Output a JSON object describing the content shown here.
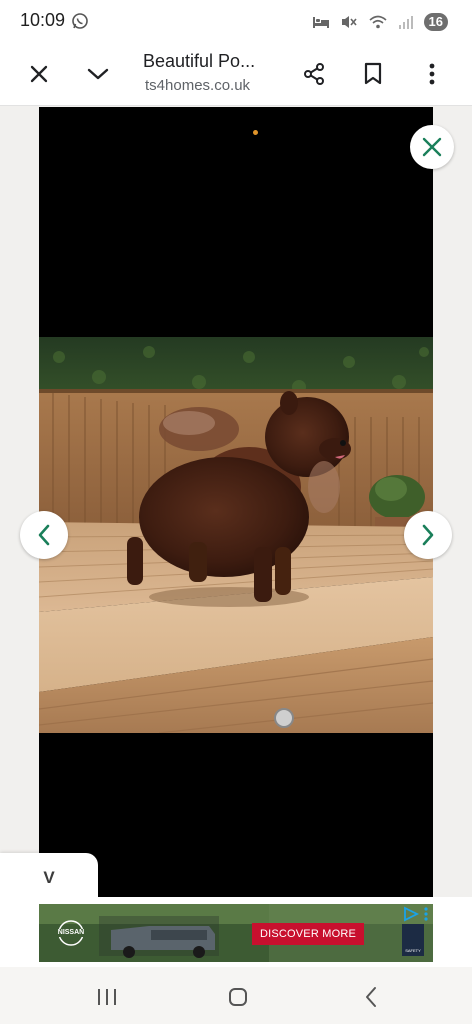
{
  "status_bar": {
    "time": "10:09",
    "battery": "16",
    "icons": [
      "whatsapp-icon",
      "bed-icon",
      "mute-icon",
      "wifi-icon",
      "signal-icon"
    ]
  },
  "toolbar": {
    "title": "Beautiful Po...",
    "url": "ts4homes.co.uk",
    "icons": [
      "close-icon",
      "chevron-down-icon",
      "share-icon",
      "bookmark-icon",
      "more-vert-icon"
    ]
  },
  "viewer": {
    "close_icon": "close-icon",
    "prev_icon": "chevron-left-icon",
    "next_icon": "chevron-right-icon"
  },
  "collapse_tab": {
    "label": "V"
  },
  "ad": {
    "brand": "NISSAN",
    "cta": "DISCOVER MORE",
    "badge": "SAFETY"
  },
  "nav_bar": {
    "icons": [
      "recent-apps-icon",
      "home-icon",
      "back-icon"
    ]
  },
  "colors": {
    "accent_green": "#1a7f5a",
    "ad_cta_red": "#c8102e",
    "viewer_background": "#000000"
  }
}
